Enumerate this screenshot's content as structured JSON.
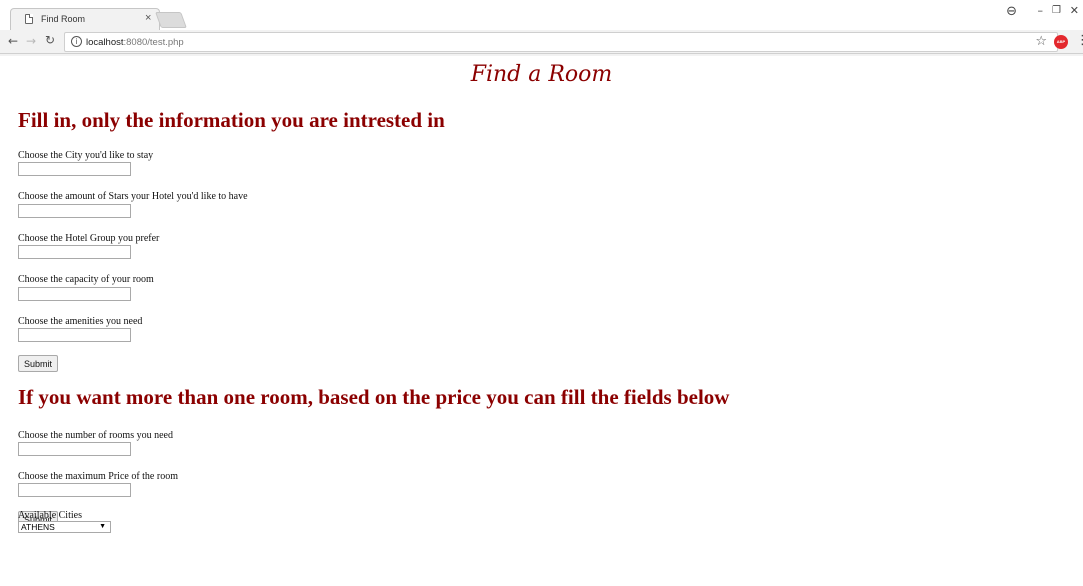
{
  "browser": {
    "tab_title": "Find Room",
    "tab_close": "×",
    "url_host": "localhost",
    "url_path": ":8080/test.php",
    "ext_label": "ABP"
  },
  "page": {
    "title": "Find a Room",
    "section1_heading": "Fill in, only the information you are intrested in",
    "fields1": [
      {
        "label": "Choose the City you'd like to stay",
        "value": ""
      },
      {
        "label": "Choose the amount of Stars your Hotel you'd like to have",
        "value": ""
      },
      {
        "label": "Choose the Hotel Group you prefer",
        "value": ""
      },
      {
        "label": "Choose the capacity of your room",
        "value": ""
      },
      {
        "label": "Choose the amenities you need",
        "value": ""
      }
    ],
    "submit1": "Submit",
    "section2_heading": "If you want more than one room, based on the price you can fill the fields below",
    "fields2": [
      {
        "label": "Choose the number of rooms you need",
        "value": ""
      },
      {
        "label": "Choose the maximum Price of the room",
        "value": ""
      }
    ],
    "submit2": "Submit",
    "cities_label": "Available Cities",
    "city_selected": "ATHENS"
  },
  "colors": {
    "heading": "#8b0000"
  },
  "icons": [
    "page-icon",
    "close-icon",
    "profile-icon",
    "minimize-icon",
    "restore-icon",
    "back-icon",
    "forward-icon",
    "reload-icon",
    "info-icon",
    "star-icon",
    "adblock-icon",
    "menu-icon",
    "chevron-down-icon"
  ]
}
